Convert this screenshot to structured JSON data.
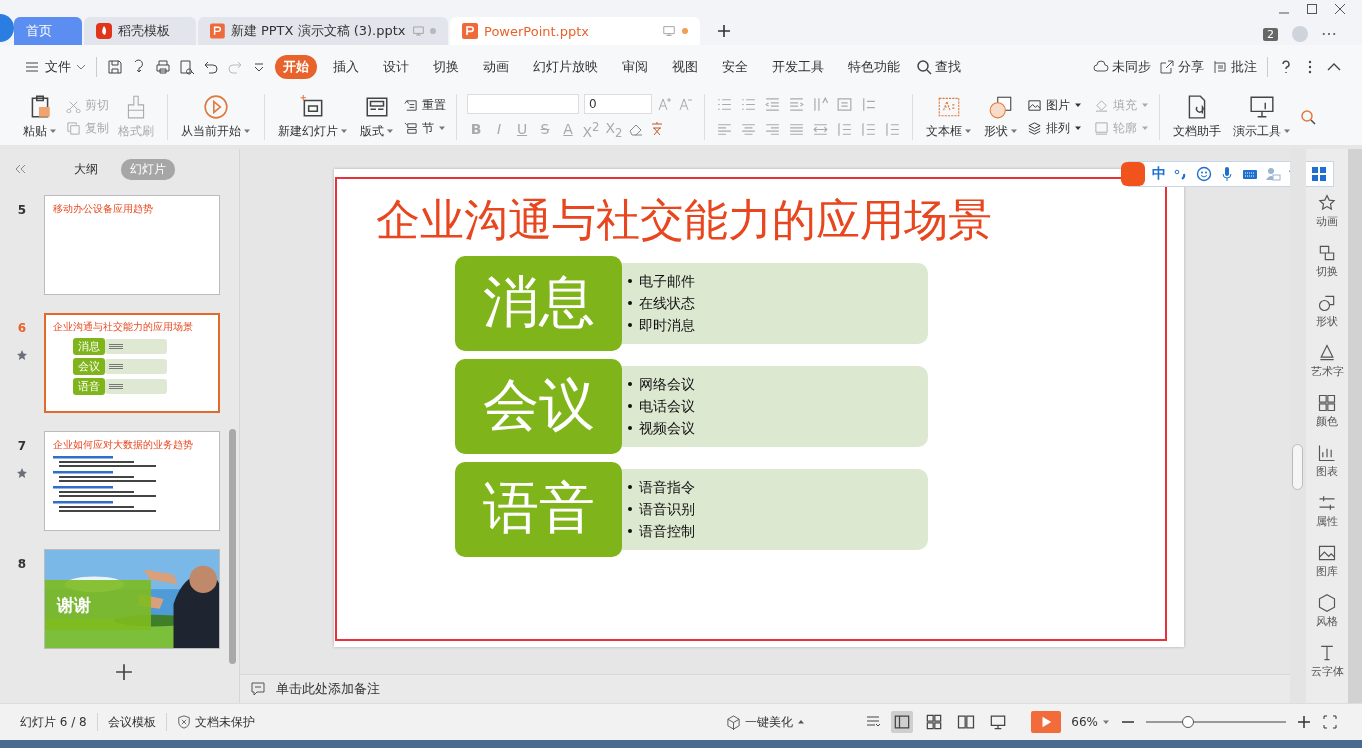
{
  "tabs": [
    {
      "label": "首页",
      "kind": "home",
      "selected": false
    },
    {
      "label": "稻壳模板",
      "kind": "template",
      "selected": false
    },
    {
      "label": "新建 PPTX 演示文稿 (3).pptx",
      "kind": "doc",
      "selected": false
    },
    {
      "label": "PowerPoint.pptx",
      "kind": "doc",
      "selected": true
    }
  ],
  "window": {
    "count": "2"
  },
  "menu": {
    "file": "文件",
    "items": [
      {
        "label": "开始",
        "selected": true
      },
      {
        "label": "插入",
        "selected": false
      },
      {
        "label": "设计",
        "selected": false
      },
      {
        "label": "切换",
        "selected": false
      },
      {
        "label": "动画",
        "selected": false
      },
      {
        "label": "幻灯片放映",
        "selected": false
      },
      {
        "label": "审阅",
        "selected": false
      },
      {
        "label": "视图",
        "selected": false
      },
      {
        "label": "安全",
        "selected": false
      },
      {
        "label": "开发工具",
        "selected": false
      },
      {
        "label": "特色功能",
        "selected": false
      }
    ],
    "search": "查找",
    "actions": [
      "未同步",
      "分享",
      "批注"
    ]
  },
  "ribbon": {
    "paste": "粘贴",
    "clip": [
      {
        "label": "剪切",
        "disabled": true
      },
      {
        "label": "复制",
        "disabled": true
      }
    ],
    "format_painter": {
      "label": "格式刷",
      "disabled": true
    },
    "play": "从当前开始",
    "new_slide": "新建幻灯片",
    "layout": "版式",
    "slide_tools": [
      "重置",
      "节"
    ],
    "font_size": "0",
    "format_buttons": [
      {
        "label": "B",
        "disabled": true
      },
      {
        "label": "I",
        "disabled": true
      },
      {
        "label": "U",
        "disabled": true
      },
      {
        "label": "S",
        "disabled": true
      },
      {
        "label": "A",
        "disabled": true
      },
      {
        "label": "X$^{2}$",
        "disabled": true
      },
      {
        "label": "X$_{2}$",
        "disabled": true
      }
    ],
    "insert": [
      "文本框",
      "形状"
    ],
    "arrange": [
      {
        "label": "图片",
        "disabled": false
      },
      {
        "label": "填充",
        "disabled": true
      },
      {
        "label": "排列",
        "disabled": false
      },
      {
        "label": "轮廓",
        "disabled": true
      }
    ],
    "tools": [
      "文档助手",
      "演示工具"
    ]
  },
  "panel": {
    "tabs": [
      {
        "label": "大纲",
        "selected": false
      },
      {
        "label": "幻灯片",
        "selected": true
      }
    ],
    "thumbnails": [
      {
        "number": "5",
        "kind": "title",
        "title": "移动办公设备应用趋势",
        "animated": false,
        "selected": false
      },
      {
        "number": "6",
        "kind": "blocks",
        "title": "企业沟通与社交能力的应用场景",
        "blocks": [
          "消息",
          "会议",
          "语音"
        ],
        "animated": true,
        "selected": true
      },
      {
        "number": "7",
        "kind": "list",
        "title": "企业如何应对大数据的业务趋势",
        "animated": true,
        "selected": false
      },
      {
        "number": "8",
        "title": "谢谢",
        "animated": false,
        "selected": false
      }
    ]
  },
  "slide": {
    "title": "企业沟通与社交能力的应用场景",
    "rows": [
      {
        "heading": "消息",
        "bullets": [
          "电子邮件",
          "在线状态",
          "即时消息"
        ]
      },
      {
        "heading": "会议",
        "bullets": [
          "网络会议",
          "电话会议",
          "视频会议"
        ]
      },
      {
        "heading": "语音",
        "bullets": [
          "语音指令",
          "语音识别",
          "语音控制"
        ]
      }
    ]
  },
  "ime": {
    "mode": "中"
  },
  "notes": "单击此处添加备注",
  "sidebar": [
    "动画",
    "切换",
    "形状",
    "艺术字",
    "颜色",
    "图表",
    "属性",
    "图库",
    "风格",
    "云字体"
  ],
  "status": {
    "slide": "幻灯片 6 / 8",
    "template": "会议模板",
    "protection": "文档未保护",
    "beautify": "一键美化",
    "views": [
      {
        "selected": true
      },
      {
        "selected": false
      },
      {
        "selected": false
      },
      {
        "selected": false
      }
    ],
    "zoom": "66%",
    "level": 0.3
  }
}
